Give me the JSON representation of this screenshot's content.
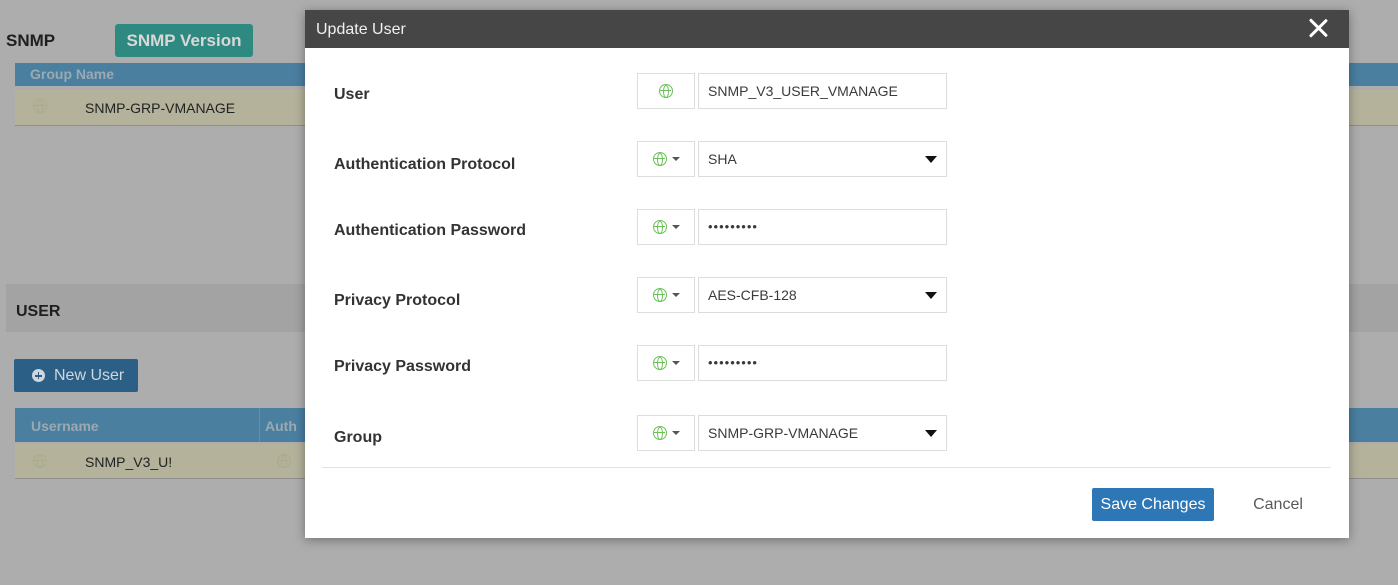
{
  "background": {
    "snmp_title": "SNMP",
    "snmp_version_button": "SNMP Version",
    "group_table": {
      "header": "Group Name",
      "rows": [
        {
          "name": "SNMP-GRP-VMANAGE"
        }
      ]
    },
    "user_section_title": "USER",
    "new_user_button": "New User",
    "user_table": {
      "headers": [
        "Username",
        "Auth"
      ],
      "rows": [
        {
          "username": "SNMP_V3_U!"
        }
      ]
    }
  },
  "modal": {
    "title": "Update User",
    "fields": [
      {
        "label": "User",
        "value": "SNMP_V3_USER_VMANAGE",
        "type": "text"
      },
      {
        "label": "Authentication Protocol",
        "value": "SHA",
        "type": "select"
      },
      {
        "label": "Authentication Password",
        "value": "•••••••••",
        "type": "password"
      },
      {
        "label": "Privacy Protocol",
        "value": "AES-CFB-128",
        "type": "select"
      },
      {
        "label": "Privacy Password",
        "value": "•••••••••",
        "type": "password"
      },
      {
        "label": "Group",
        "value": "SNMP-GRP-VMANAGE",
        "type": "select"
      }
    ],
    "save_button": "Save Changes",
    "cancel_button": "Cancel"
  },
  "colors": {
    "header_bg": "#464646",
    "save_button": "#2e77b7",
    "globe_icon": "#6cbf5a"
  },
  "icons": {
    "scope": "globe-icon",
    "close": "close-icon",
    "dropdown": "caret-down-icon",
    "add": "plus-circle-icon"
  }
}
